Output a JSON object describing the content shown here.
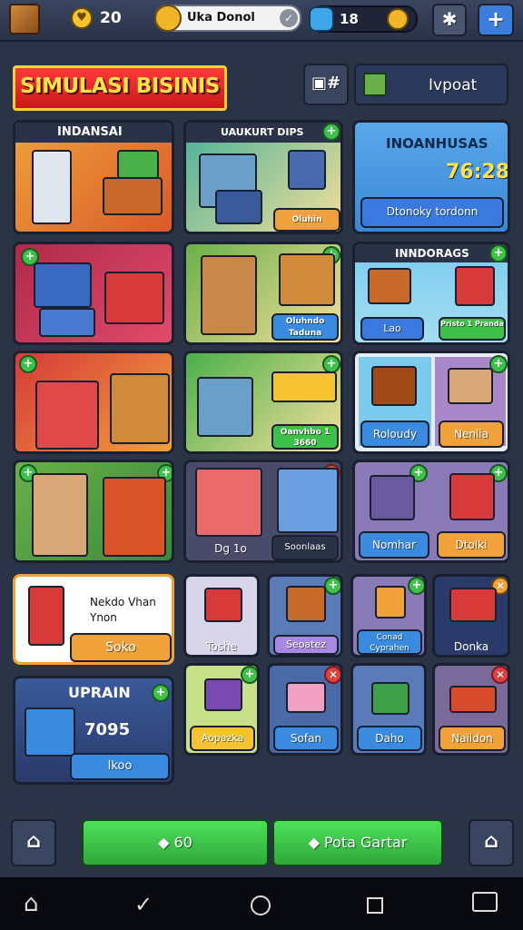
{
  "topbar": {
    "level": "20",
    "name": "Uka Donol",
    "gems": "18"
  },
  "header": {
    "title": "SIMULASI BISINIS",
    "report_label": "Ivpoat"
  },
  "grid": {
    "r1c1": {
      "label": "INDANSAI"
    },
    "r1c2": {
      "label": "UAUKURT DIPS",
      "price": "Oluhin"
    },
    "info": {
      "title": "INOANHUSAS",
      "time": "76:28",
      "button": "Dtonoky tordonn"
    },
    "r2c3": {
      "title": "INNDORAGS",
      "btn1": "Lao",
      "btn2": "Pristo 1 Pranda"
    },
    "r2c2": {
      "price": "Oluhndo Taduna"
    },
    "r3c2": {
      "price": "Oanvhbo 1 3660"
    },
    "r3c3": {
      "btn1": "Roloudy",
      "btn2": "Nenlia"
    },
    "r4c2": {
      "btn1": "Dg 1o",
      "btn2": "Soonlaas"
    },
    "r4c3": {
      "btn1": "Nomhar",
      "btn2": "Dtolki"
    }
  },
  "bottom": {
    "shop": {
      "text": "Nekdo Vhan Ynon",
      "button": "Soko"
    },
    "upgrade": {
      "title": "UPRAIN",
      "amount": "7095",
      "button": "Ikoo"
    },
    "items": [
      {
        "label": "Toshe"
      },
      {
        "label": "Seoatez"
      },
      {
        "label": "Conad Cyprahen"
      },
      {
        "label": "Donka"
      },
      {
        "label": "Aopazka"
      },
      {
        "label": "Sofan"
      },
      {
        "label": "Daho"
      },
      {
        "label": "Naildon"
      }
    ]
  },
  "footer": {
    "btn_small": "60",
    "btn_large": "Pota Gartar"
  }
}
